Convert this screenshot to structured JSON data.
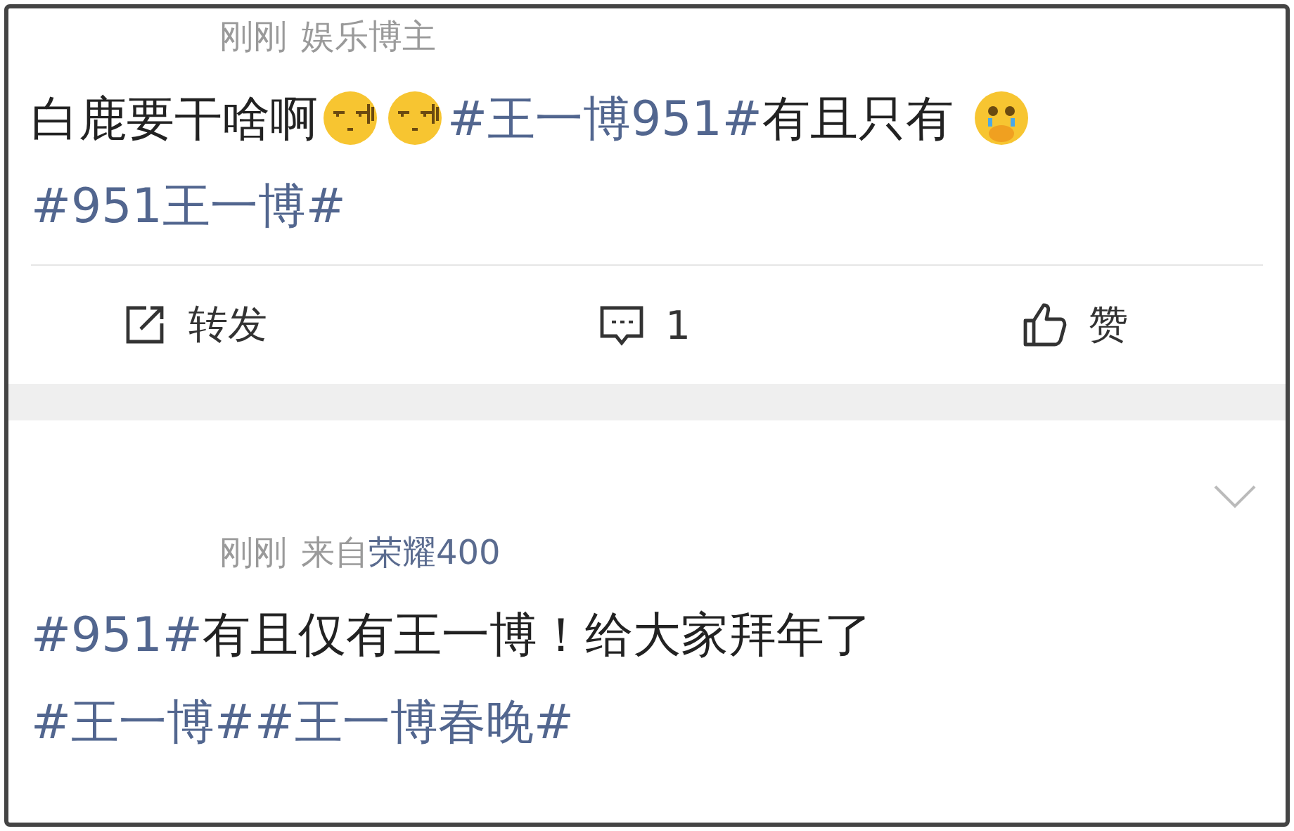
{
  "posts": [
    {
      "meta": [
        {
          "kind": "time",
          "text": "刚刚"
        },
        {
          "kind": "text",
          "text": "娱乐博主"
        }
      ],
      "body": [
        {
          "kind": "text",
          "text": "白鹿要干啥啊"
        },
        {
          "kind": "emoji"
        },
        {
          "kind": "emoji"
        },
        {
          "kind": "tag",
          "text": "#王一博951#"
        },
        {
          "kind": "text",
          "text": "有且只有 "
        },
        {
          "kind": "emoji_cry"
        },
        {
          "kind": "tag",
          "text": "#951王一博#"
        }
      ],
      "actions": [
        {
          "kind": "forward",
          "label": "转发"
        },
        {
          "kind": "comment",
          "label": "1"
        },
        {
          "kind": "like",
          "label": "赞"
        }
      ]
    },
    {
      "chevron": true,
      "meta": [
        {
          "kind": "time",
          "text": "刚刚"
        },
        {
          "kind": "text",
          "text": "来自"
        },
        {
          "kind": "link",
          "text": "荣耀400"
        }
      ],
      "body": [
        {
          "kind": "tag",
          "text": "#951#"
        },
        {
          "kind": "text",
          "text": "有且仅有王一博！给大家拜年了"
        },
        {
          "kind": "tag",
          "text": "#王一博#"
        },
        {
          "kind": "tag",
          "text": "#王一博春晚#"
        }
      ]
    }
  ]
}
